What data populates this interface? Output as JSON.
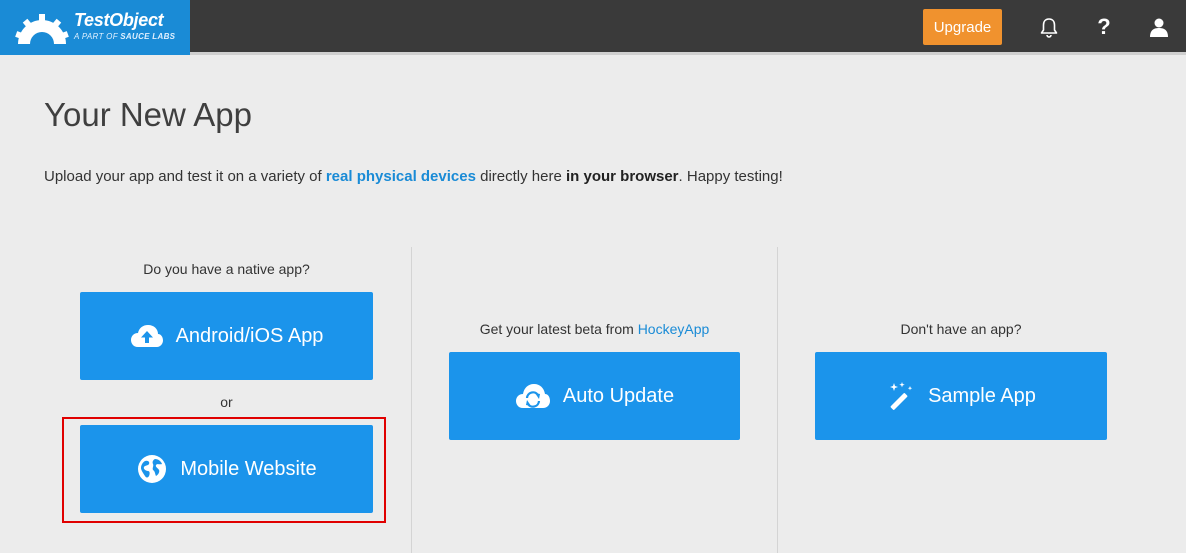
{
  "brand": {
    "name": "TestObject",
    "tagline_prefix": "A PART OF ",
    "tagline_brand": "SAUCE LABS",
    "color": "#1a8bd6"
  },
  "header": {
    "upgrade_label": "Upgrade",
    "upgrade_color": "#f0922e",
    "icons": [
      "bell-icon",
      "help-icon",
      "user-icon"
    ],
    "help_glyph": "?"
  },
  "main": {
    "title": "Your New App",
    "intro": {
      "part1": "Upload your app and test it on a variety of ",
      "link": "real physical devices",
      "part2": " directly here ",
      "bold": "in your browser",
      "part3": ". Happy testing!"
    }
  },
  "columns": {
    "native": {
      "caption": "Do you have a native app?",
      "app_button": "Android/iOS App",
      "or_text": "or",
      "website_button": "Mobile Website"
    },
    "hockey": {
      "caption_prefix": "Get your latest beta from ",
      "caption_link": "HockeyApp",
      "button": "Auto Update"
    },
    "sample": {
      "caption": "Don't have an app?",
      "button": "Sample App"
    }
  },
  "colors": {
    "button_blue": "#1b94eb",
    "highlight_red": "#e00000"
  }
}
